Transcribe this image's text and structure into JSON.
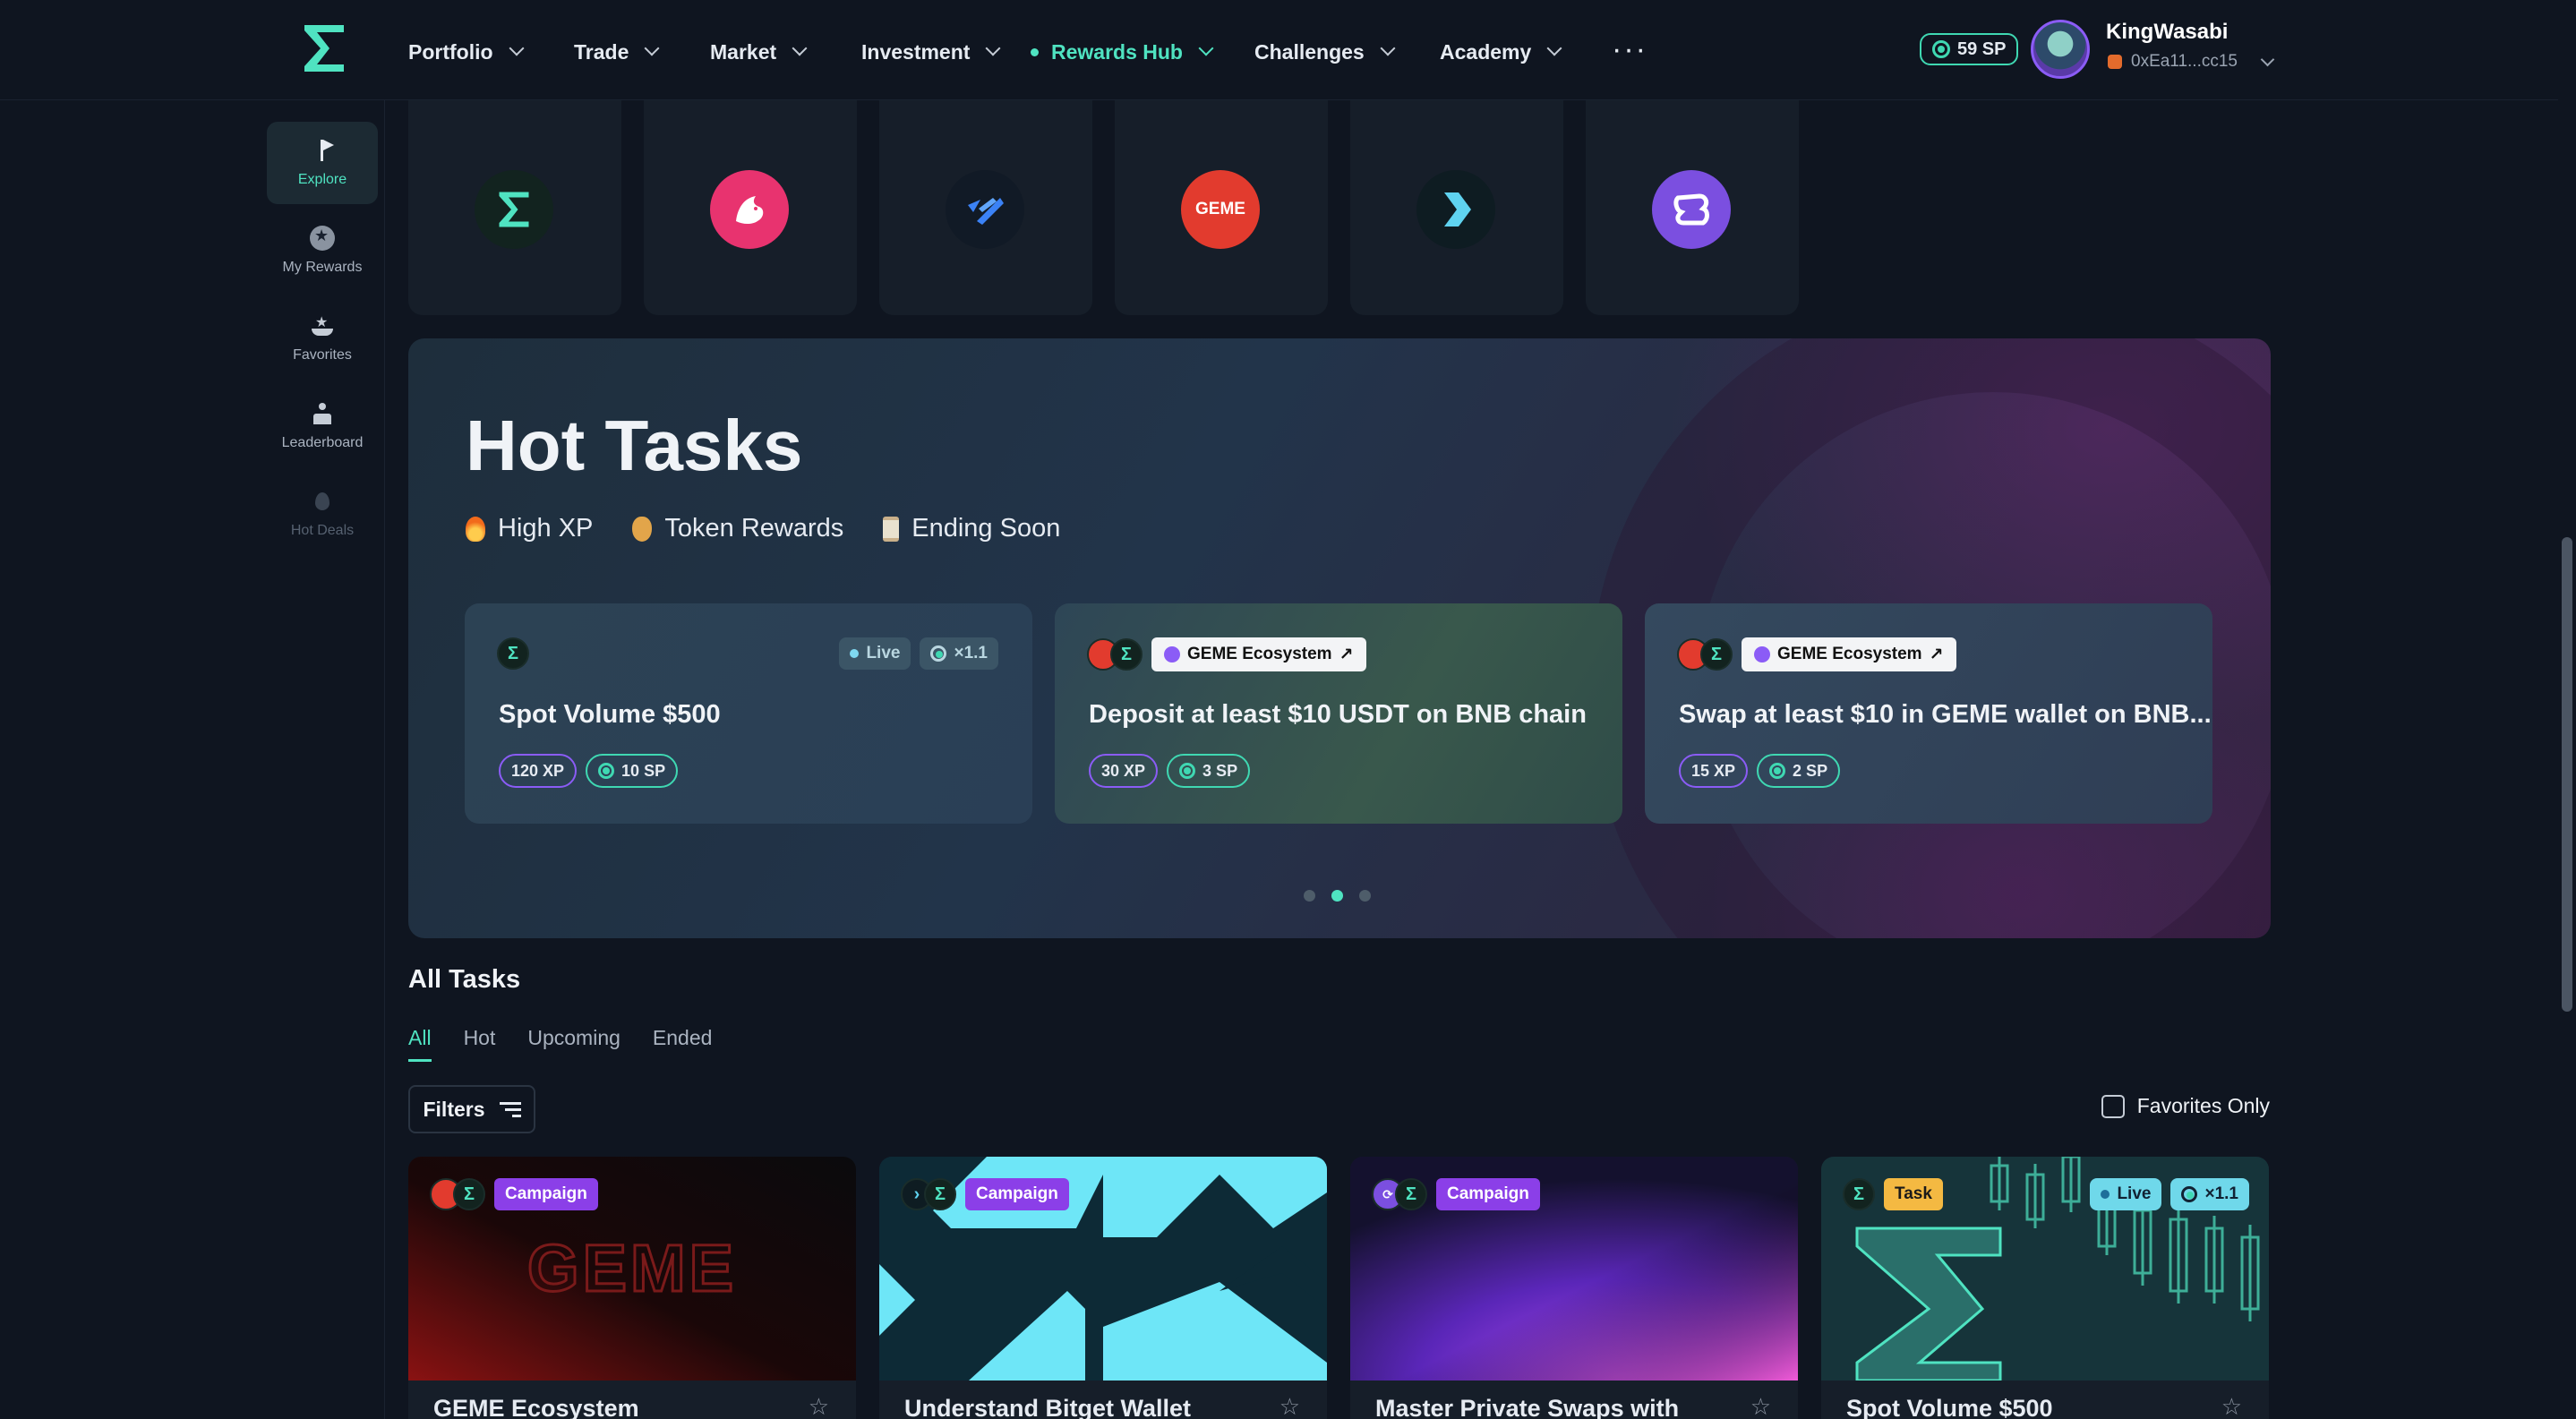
{
  "nav": {
    "items": [
      {
        "label": "Portfolio"
      },
      {
        "label": "Trade"
      },
      {
        "label": "Market"
      },
      {
        "label": "Investment"
      },
      {
        "label": "Rewards Hub"
      },
      {
        "label": "Challenges"
      },
      {
        "label": "Academy"
      }
    ],
    "more_label": "···",
    "sp_balance": "59 SP",
    "user_name": "KingWasabi",
    "wallet_address": "0xEa11...cc15"
  },
  "sidebar": {
    "items": [
      {
        "label": "Explore",
        "icon": "flag-icon"
      },
      {
        "label": "My Rewards",
        "icon": "star-badge-icon"
      },
      {
        "label": "Favorites",
        "icon": "favorites-icon"
      },
      {
        "label": "Leaderboard",
        "icon": "leaderboard-icon"
      },
      {
        "label": "Hot Deals",
        "icon": "flame-icon"
      }
    ]
  },
  "partners": [
    {
      "name": "sigma",
      "color": "#12231f"
    },
    {
      "name": "uniswap",
      "color": "#e8336f"
    },
    {
      "name": "partner-3",
      "color": "#111a26"
    },
    {
      "name": "geme",
      "color": "#e23b2e",
      "text": "GEME"
    },
    {
      "name": "partner-5",
      "color": "#0e1c22"
    },
    {
      "name": "partner-6",
      "color": "#7b4fe0"
    }
  ],
  "hot": {
    "title": "Hot Tasks",
    "tags": [
      "High XP",
      "Token Rewards",
      "Ending Soon"
    ],
    "cards": [
      {
        "title": "Spot Volume $500",
        "xp": "120 XP",
        "sp": "10 SP",
        "status": "Live",
        "multiplier": "×1.1"
      },
      {
        "title": "Deposit at least $10 USDT on BNB chain",
        "xp": "30 XP",
        "sp": "3 SP",
        "ecosystem": "GEME Ecosystem"
      },
      {
        "title": "Swap at least $10 in GEME wallet on BNB...",
        "xp": "15 XP",
        "sp": "2 SP",
        "ecosystem": "GEME Ecosystem"
      }
    ]
  },
  "all": {
    "title": "All Tasks",
    "tabs": [
      "All",
      "Hot",
      "Upcoming",
      "Ended"
    ],
    "filters_label": "Filters",
    "favorites_only_label": "Favorites Only",
    "cards": [
      {
        "category": "Campaign",
        "title": "GEME Ecosystem"
      },
      {
        "category": "Campaign",
        "title": "Understand Bitget Wallet"
      },
      {
        "category": "Campaign",
        "title": "Master Private Swaps with"
      },
      {
        "category": "Task",
        "title": "Spot Volume $500",
        "status": "Live",
        "multiplier": "×1.1"
      }
    ]
  },
  "colors": {
    "accent": "#4fe3c1",
    "xp": "#8b5cf6",
    "campaign": "#8b3fe8",
    "task": "#f4b942"
  }
}
